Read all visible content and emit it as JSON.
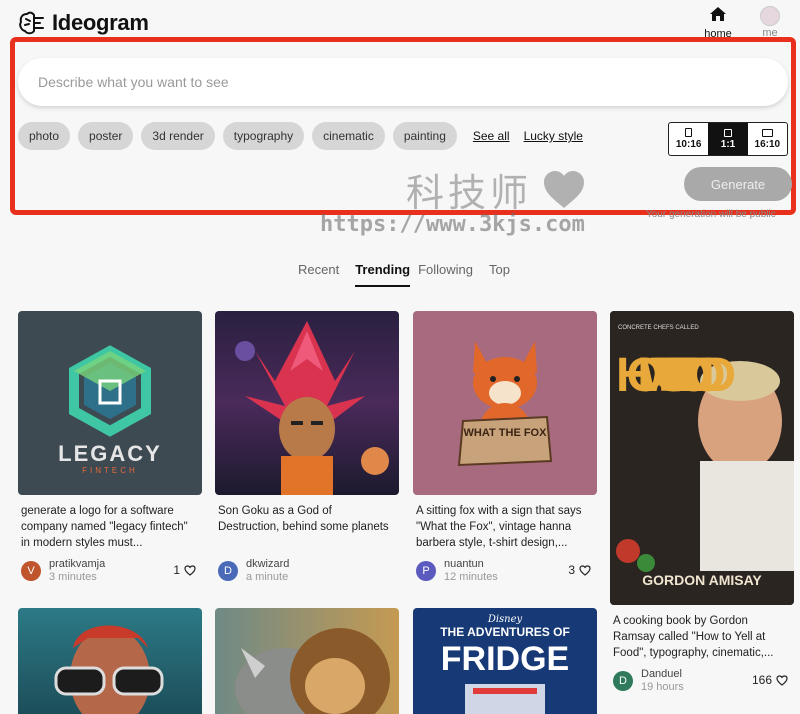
{
  "app": {
    "name": "Ideogram"
  },
  "nav": {
    "home_label": "home",
    "me_label": "me"
  },
  "prompt": {
    "placeholder": "Describe what you want to see"
  },
  "chips": [
    "photo",
    "poster",
    "3d render",
    "typography",
    "cinematic",
    "painting"
  ],
  "links": {
    "see_all": "See all",
    "lucky": "Lucky style"
  },
  "aspect_ratio": {
    "options": [
      "10:16",
      "1:1",
      "16:10"
    ],
    "selected": "1:1"
  },
  "generate_label": "Generate",
  "public_note": "Your generation will be public",
  "watermark": {
    "cn": "科技师",
    "url": "https://www.3kjs.com"
  },
  "feed_tabs": [
    "Recent",
    "Trending",
    "Following",
    "Top"
  ],
  "active_tab": "Trending",
  "cards": [
    {
      "caption": "generate a logo for a software company named \"legacy fintech\" in modern styles must...",
      "user": "pratikvamja",
      "initial": "V",
      "time": "3 minutes",
      "likes": "1",
      "avatar_color": "#c0542c",
      "thumb_text": "LEGACY",
      "thumb_sub": "FINTECH"
    },
    {
      "caption": "Son Goku as a God of Destruction, behind some planets",
      "user": "dkwizard",
      "initial": "D",
      "time": "a minute",
      "likes": "",
      "avatar_color": "#4a6ab8"
    },
    {
      "caption": "A sitting fox with a sign that says \"What the Fox\", vintage hanna barbera style, t-shirt design,...",
      "user": "nuantun",
      "initial": "P",
      "time": "12 minutes",
      "likes": "3",
      "avatar_color": "#5b5bbf",
      "thumb_text": "WHAT THE FOX"
    },
    {
      "caption": "A cooking book by Gordon Ramsay called \"How to Yell at Food\", typography, cinematic,...",
      "user": "Danduel",
      "initial": "D",
      "time": "19 hours",
      "likes": "166",
      "avatar_color": "#2f7a5a",
      "thumb_text": "HOW TO YELL AT FOOD",
      "thumb_small": "CONCRETE CHEFS CALLED",
      "thumb_sub": "GORDON AMISAY"
    },
    {
      "caption": "",
      "user": "",
      "time": "",
      "likes": ""
    },
    {
      "caption": "",
      "user": "",
      "time": "",
      "likes": ""
    },
    {
      "caption": "",
      "user": "",
      "time": "",
      "likes": "",
      "thumb_brand": "Disney",
      "thumb_text": "THE ADVENTURES OF",
      "thumb_sub": "FRIDGE"
    }
  ]
}
